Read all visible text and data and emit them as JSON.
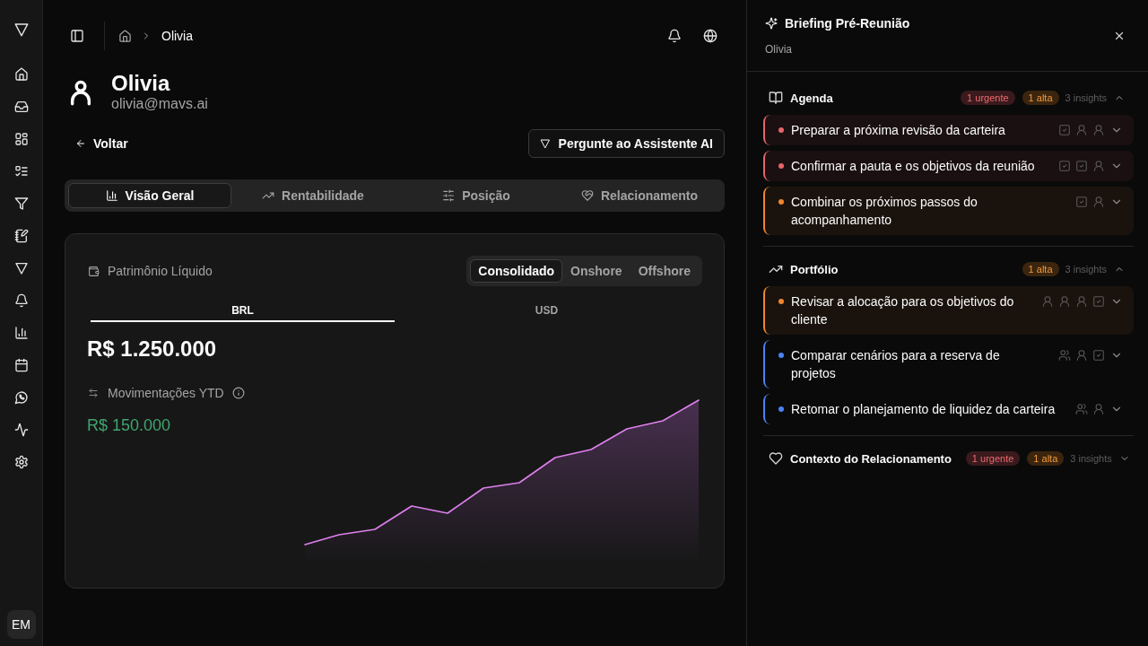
{
  "rail": {
    "avatar": "EM"
  },
  "breadcrumb": {
    "current": "Olivia"
  },
  "profile": {
    "name": "Olivia",
    "email": "olivia@mavs.ai"
  },
  "back_link": "Voltar",
  "assistant_button": "Pergunte ao Assistente AI",
  "tabs": [
    {
      "label": "Visão Geral",
      "selected": true
    },
    {
      "label": "Rentabilidade",
      "selected": false
    },
    {
      "label": "Posição",
      "selected": false
    },
    {
      "label": "Relacionamento",
      "selected": false
    }
  ],
  "net_worth": {
    "title": "Patrimônio Líquido",
    "scopes": [
      {
        "label": "Consolidado",
        "selected": true
      },
      {
        "label": "Onshore",
        "selected": false
      },
      {
        "label": "Offshore",
        "selected": false
      }
    ],
    "currencies": [
      {
        "label": "BRL",
        "selected": true
      },
      {
        "label": "USD",
        "selected": false
      }
    ],
    "amount": "R$ 1.250.000",
    "movements": {
      "label": "Movimentações YTD",
      "amount": "R$ 150.000"
    }
  },
  "briefing": {
    "title": "Briefing Pré-Reunião",
    "subtitle": "Olivia",
    "sections": [
      {
        "title": "Agenda",
        "badges": [
          {
            "kind": "urgent",
            "label": "1 urgente"
          },
          {
            "kind": "high",
            "label": "1 alta"
          }
        ],
        "count": "3 insights",
        "expanded": true,
        "items": [
          {
            "text": "Preparar a próxima revisão da carteira",
            "color": "#e8646b",
            "highlighted": true,
            "expanded": false,
            "indicators": [
              {
                "kind": "task"
              },
              {
                "kind": "person"
              },
              {
                "kind": "person"
              }
            ]
          },
          {
            "text": "Confirmar a pauta e os objetivos da reunião",
            "color": "#e8646b",
            "highlighted": true,
            "expanded": false,
            "indicators": [
              {
                "kind": "task"
              },
              {
                "kind": "task"
              },
              {
                "kind": "person"
              }
            ]
          },
          {
            "text": "Combinar os próximos passos do acompanhamento",
            "color": "#f0862f",
            "highlighted": true,
            "expanded": false,
            "indicators": [
              {
                "kind": "task"
              },
              {
                "kind": "person"
              }
            ]
          }
        ]
      },
      {
        "title": "Portfólio",
        "badges": [
          {
            "kind": "high",
            "label": "1 alta"
          }
        ],
        "count": "3 insights",
        "expanded": true,
        "items": [
          {
            "text": "Revisar a alocação para os objetivos do cliente",
            "color": "#f0862f",
            "highlighted": true,
            "expanded": false,
            "indicators": [
              {
                "kind": "person"
              },
              {
                "kind": "person"
              },
              {
                "kind": "person"
              },
              {
                "kind": "task"
              }
            ]
          },
          {
            "text": "Comparar cenários para a reserva de projetos",
            "color": "#4a83f5",
            "highlighted": false,
            "expanded": false,
            "indicators": [
              {
                "kind": "group"
              },
              {
                "kind": "person"
              },
              {
                "kind": "task"
              }
            ]
          },
          {
            "text": "Retomar o planejamento de liquidez da carteira",
            "color": "#4a83f5",
            "highlighted": false,
            "expanded": false,
            "indicators": [
              {
                "kind": "group"
              },
              {
                "kind": "person"
              }
            ]
          }
        ]
      },
      {
        "title": "Contexto do Relacionamento",
        "badges": [
          {
            "kind": "urgent",
            "label": "1 urgente"
          },
          {
            "kind": "high",
            "label": "1 alta"
          }
        ],
        "count": "3 insights",
        "expanded": false
      }
    ]
  }
}
